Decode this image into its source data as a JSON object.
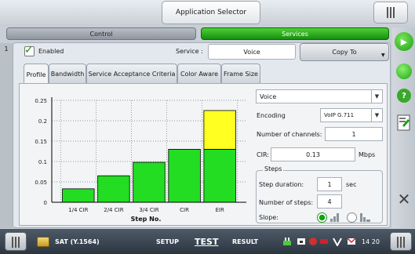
{
  "header": {
    "app_selector": "Application Selector"
  },
  "tabs": {
    "control": "Control",
    "services": "Services"
  },
  "service_row": {
    "service_number": "1",
    "enabled_label": "Enabled",
    "enabled": true,
    "service_label": "Service :",
    "service_value": "Voice",
    "copy_to": "Copy To"
  },
  "subtabs": [
    "Profile",
    "Bandwidth",
    "Service Acceptance Criteria",
    "Color Aware",
    "Frame Size"
  ],
  "active_subtab": "Profile",
  "settings": {
    "profile": "Voice",
    "encoding_label": "Encoding",
    "encoding_value": "VoIP G.711",
    "channels_label": "Number of channels:",
    "channels_value": "1",
    "cir_label": "CIR:",
    "cir_value": "0.13",
    "cir_unit": "Mbps",
    "steps_title": "Steps",
    "step_duration_label": "Step duration:",
    "step_duration_value": "1",
    "step_duration_unit": "sec",
    "num_steps_label": "Number of steps:",
    "num_steps_value": "4",
    "slope_label": "Slope:"
  },
  "chart_data": {
    "type": "bar",
    "categories": [
      "1/4 CIR",
      "2/4 CIR",
      "3/4 CIR",
      "CIR",
      "EIR"
    ],
    "series": [
      {
        "values": [
          0.033,
          0.065,
          0.098,
          0.13,
          0.13
        ],
        "color": "#22dd22"
      },
      {
        "values": [
          0,
          0,
          0,
          0,
          0.095
        ],
        "color": "#ffff22"
      }
    ],
    "yticks": [
      "0",
      "0.05",
      "0.1",
      "0.15",
      "0.2",
      "0.25"
    ],
    "ylim": [
      0,
      0.25
    ],
    "xlabel": "Step No.",
    "ylabel": "",
    "grid": true
  },
  "bottom": {
    "app_name": "SAT (Y.1564)",
    "setup": "SETUP",
    "test": "TEST",
    "result": "RESULT",
    "time": "14 20"
  },
  "colors": {
    "accent_green": "#18a10e",
    "bar_green": "#22dd22",
    "bar_yellow": "#ffff22"
  }
}
